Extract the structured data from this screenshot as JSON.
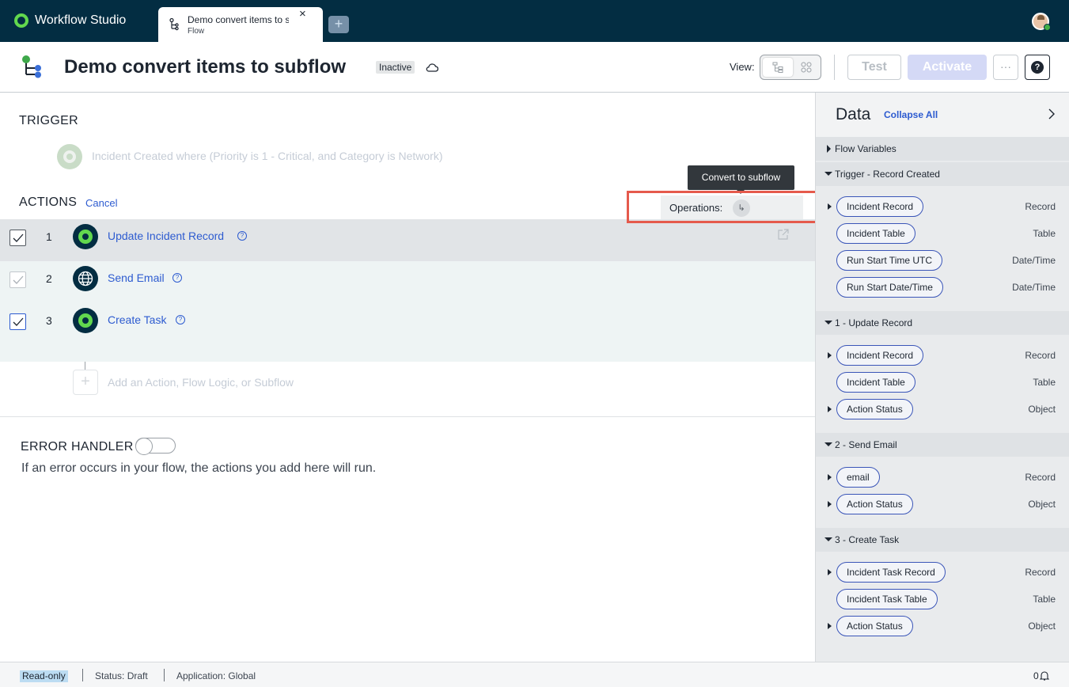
{
  "app": {
    "brand": "Workflow Studio",
    "tab": {
      "title": "Demo convert items to subflow",
      "subtitle": "Flow",
      "close_glyph": "×",
      "add_glyph": "+"
    }
  },
  "header": {
    "title": "Demo convert items to subflow",
    "status": "Inactive",
    "view_label": "View:",
    "test_label": "Test",
    "activate_label": "Activate",
    "more_glyph": "···",
    "help_glyph": "?"
  },
  "trigger": {
    "section_title": "TRIGGER",
    "text": "Incident Created where (Priority is 1 - Critical, and Category is Network)"
  },
  "actions": {
    "section_title": "ACTIONS",
    "cancel_label": "Cancel",
    "tooltip": "Convert to subflow",
    "operations_label": "Operations:",
    "operations_glyph": "↳",
    "items": [
      {
        "num": "1",
        "label": "Update Incident Record",
        "icon": "record-icon",
        "checked": true,
        "selected": true
      },
      {
        "num": "2",
        "label": "Send Email",
        "icon": "globe-icon",
        "checked": true,
        "disabled": true
      },
      {
        "num": "3",
        "label": "Create Task",
        "icon": "record-icon",
        "checked": true
      }
    ],
    "add_glyph": "+",
    "add_label": "Add an Action, Flow Logic, or Subflow"
  },
  "error_handler": {
    "title": "ERROR HANDLER",
    "description": "If an error occurs in your flow, the actions you add here will run."
  },
  "data_panel": {
    "title": "Data",
    "collapse_all": "Collapse All",
    "groups": [
      {
        "title": "Flow Variables",
        "expanded": false,
        "items": []
      },
      {
        "title": "Trigger - Record Created",
        "expanded": true,
        "items": [
          {
            "label": "Incident Record",
            "type": "Record",
            "expandable": true
          },
          {
            "label": "Incident Table",
            "type": "Table",
            "expandable": false
          },
          {
            "label": "Run Start Time UTC",
            "type": "Date/Time",
            "expandable": false
          },
          {
            "label": "Run Start Date/Time",
            "type": "Date/Time",
            "expandable": false
          }
        ]
      },
      {
        "title": "1 - Update Record",
        "expanded": true,
        "items": [
          {
            "label": "Incident Record",
            "type": "Record",
            "expandable": true
          },
          {
            "label": "Incident Table",
            "type": "Table",
            "expandable": false
          },
          {
            "label": "Action Status",
            "type": "Object",
            "expandable": true
          }
        ]
      },
      {
        "title": "2 - Send Email",
        "expanded": true,
        "items": [
          {
            "label": "email",
            "type": "Record",
            "expandable": true
          },
          {
            "label": "Action Status",
            "type": "Object",
            "expandable": true
          }
        ]
      },
      {
        "title": "3 - Create Task",
        "expanded": true,
        "items": [
          {
            "label": "Incident Task Record",
            "type": "Record",
            "expandable": true
          },
          {
            "label": "Incident Task Table",
            "type": "Table",
            "expandable": false
          },
          {
            "label": "Action Status",
            "type": "Object",
            "expandable": true
          }
        ]
      }
    ]
  },
  "footer": {
    "read_only": "Read-only",
    "status": "Status: Draft",
    "application": "Application: Global",
    "notification_count": "0"
  },
  "colors": {
    "topbar": "#032d42",
    "brand_green": "#62d84e",
    "link_blue": "#2d5bd0",
    "highlight_red": "#e55a4c",
    "activate_disabled": "#d4d9f6"
  }
}
